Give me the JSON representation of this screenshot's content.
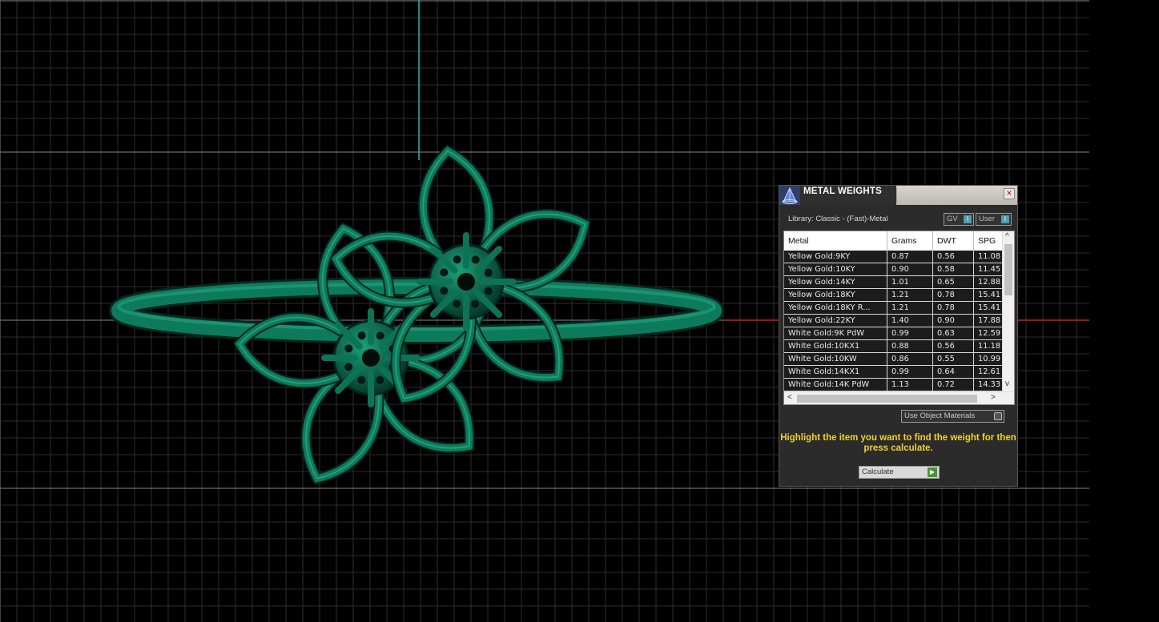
{
  "panel": {
    "title": "METAL WEIGHTS",
    "close_symbol": "×",
    "library_label": "Library: Classic - (Fast)-Metal",
    "toggles": [
      {
        "label": "GV",
        "indicator": "I"
      },
      {
        "label": "User",
        "indicator": "I"
      }
    ],
    "table": {
      "columns": [
        "Metal",
        "Grams",
        "DWT",
        "SPG"
      ],
      "rows": [
        [
          "Yellow Gold:9KY",
          "0.87",
          "0.56",
          "11.08"
        ],
        [
          "Yellow Gold:10KY",
          "0.90",
          "0.58",
          "11.45"
        ],
        [
          "Yellow Gold:14KY",
          "1.01",
          "0.65",
          "12.88"
        ],
        [
          "Yellow Gold:18KY",
          "1.21",
          "0.78",
          "15.41"
        ],
        [
          "Yellow Gold:18KY R...",
          "1.21",
          "0.78",
          "15.41"
        ],
        [
          "Yellow Gold:22KY",
          "1.40",
          "0.90",
          "17.88"
        ],
        [
          "White Gold:9K PdW",
          "0.99",
          "0.63",
          "12.59"
        ],
        [
          "White Gold:10KX1",
          "0.88",
          "0.56",
          "11.18"
        ],
        [
          "White Gold:10KW",
          "0.86",
          "0.55",
          "10.99"
        ],
        [
          "White Gold:14KX1",
          "0.99",
          "0.64",
          "12.61"
        ],
        [
          "White Gold:14K PdW",
          "1.13",
          "0.72",
          "14.33"
        ]
      ]
    },
    "scroll": {
      "up": "^",
      "down": "v",
      "left": "<",
      "right": ">"
    },
    "use_object_materials": "Use Object Materials",
    "hint": "Highlight the item you want to find the weight for then press calculate.",
    "calculate_label": "Calculate",
    "calculate_icon": "▶"
  },
  "colors": {
    "ring_green": "#0e7a5c",
    "grid": "#5a5a5a",
    "axis_x": "#c01818",
    "axis_y": "#3aa7b8",
    "hint": "#f2d12f"
  }
}
